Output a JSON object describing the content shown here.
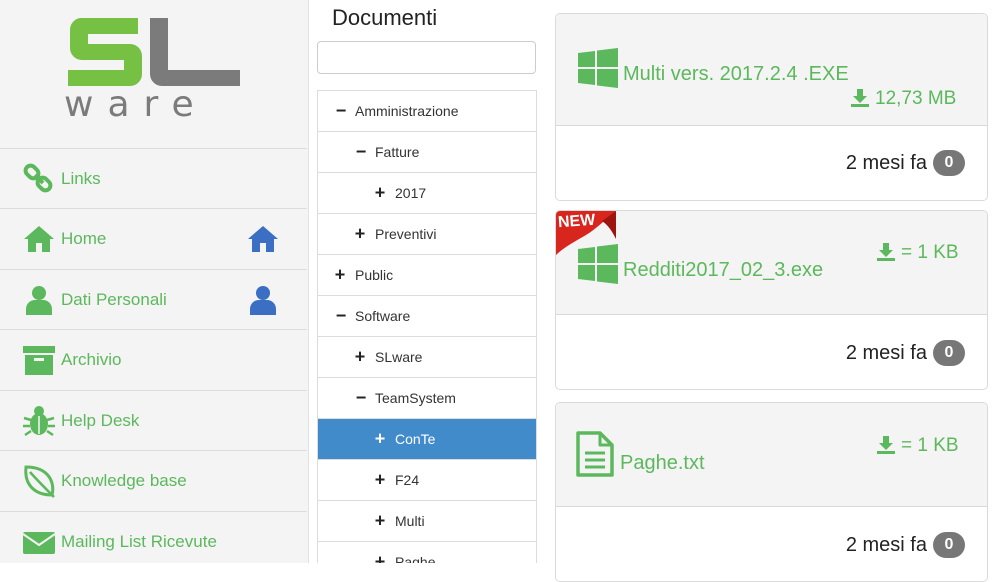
{
  "colors": {
    "accent_green": "#5cb85c",
    "nav_blue": "#3a6fc4",
    "tree_active": "#428bca",
    "badge_gray": "#777777"
  },
  "sidebar": {
    "logo_text": "SLware",
    "items": [
      {
        "label": "Links",
        "icon": "link-icon",
        "right_icon": ""
      },
      {
        "label": "Home",
        "icon": "home-icon",
        "right_icon": "home-icon"
      },
      {
        "label": "Dati Personali",
        "icon": "user-icon",
        "right_icon": "user-icon"
      },
      {
        "label": "Archivio",
        "icon": "archive-box-icon",
        "right_icon": ""
      },
      {
        "label": "Help Desk",
        "icon": "bug-icon",
        "right_icon": ""
      },
      {
        "label": "Knowledge base",
        "icon": "leaf-icon",
        "right_icon": ""
      },
      {
        "label": "Mailing List Ricevute",
        "icon": "envelope-icon",
        "right_icon": ""
      }
    ]
  },
  "documents": {
    "title": "Documenti",
    "search_value": "",
    "tree": [
      {
        "label": "Amministrazione",
        "symbol": "−",
        "depth": 0,
        "active": false
      },
      {
        "label": "Fatture",
        "symbol": "−",
        "depth": 1,
        "active": false
      },
      {
        "label": "2017",
        "symbol": "+",
        "depth": 2,
        "active": false
      },
      {
        "label": "Preventivi",
        "symbol": "+",
        "depth": 1,
        "active": false
      },
      {
        "label": "Public",
        "symbol": "+",
        "depth": 0,
        "active": false
      },
      {
        "label": "Software",
        "symbol": "−",
        "depth": 0,
        "active": false
      },
      {
        "label": "SLware",
        "symbol": "+",
        "depth": 1,
        "active": false
      },
      {
        "label": "TeamSystem",
        "symbol": "−",
        "depth": 1,
        "active": false
      },
      {
        "label": "ConTe",
        "symbol": "+",
        "depth": 2,
        "active": true
      },
      {
        "label": "F24",
        "symbol": "+",
        "depth": 2,
        "active": false
      },
      {
        "label": "Multi",
        "symbol": "+",
        "depth": 2,
        "active": false
      },
      {
        "label": "Paghe",
        "symbol": "+",
        "depth": 2,
        "active": false
      }
    ]
  },
  "files": [
    {
      "name": "Multi vers. 2017.2.4 .EXE",
      "size": "12,73 MB",
      "when": "2 mesi fa",
      "count": "0",
      "icon": "windows-icon",
      "is_new": false
    },
    {
      "name": "Redditi2017_02_3.exe",
      "size": "= 1 KB",
      "when": "2 mesi fa",
      "count": "0",
      "icon": "windows-icon",
      "is_new": true,
      "ribbon": "NEW"
    },
    {
      "name": "Paghe.txt",
      "size": "= 1 KB",
      "when": "2 mesi fa",
      "count": "0",
      "icon": "text-file-icon",
      "is_new": false
    }
  ]
}
